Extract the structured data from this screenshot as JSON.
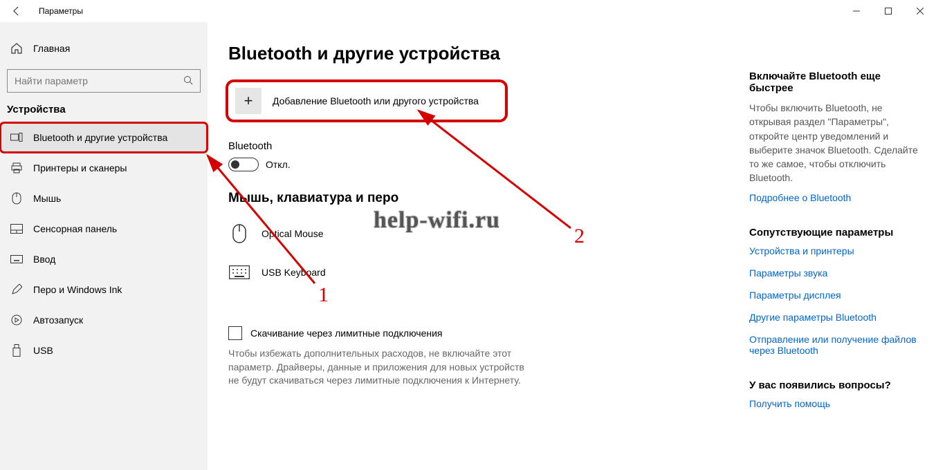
{
  "window": {
    "title": "Параметры"
  },
  "sidebar": {
    "home": "Главная",
    "search_placeholder": "Найти параметр",
    "section": "Устройства",
    "items": [
      {
        "label": "Bluetooth и другие устройства",
        "icon": "devices"
      },
      {
        "label": "Принтеры и сканеры",
        "icon": "printer"
      },
      {
        "label": "Мышь",
        "icon": "mouse"
      },
      {
        "label": "Сенсорная панель",
        "icon": "touchpad"
      },
      {
        "label": "Ввод",
        "icon": "keyboard"
      },
      {
        "label": "Перо и Windows Ink",
        "icon": "pen"
      },
      {
        "label": "Автозапуск",
        "icon": "autoplay"
      },
      {
        "label": "USB",
        "icon": "usb"
      }
    ]
  },
  "main": {
    "heading": "Bluetooth и другие устройства",
    "add_label": "Добавление Bluetooth или другого устройства",
    "bt_label": "Bluetooth",
    "bt_state": "Откл.",
    "devices_heading": "Мышь, клавиатура и перо",
    "devices": [
      {
        "label": "Optical Mouse"
      },
      {
        "label": "USB Keyboard"
      }
    ],
    "metered_checkbox": "Скачивание через лимитные подключения",
    "metered_desc": "Чтобы избежать дополнительных расходов, не включайте этот параметр. Драйверы, данные и приложения для новых устройств не будут скачиваться через лимитные подключения к Интернету."
  },
  "aside": {
    "g1_title": "Включайте Bluetooth еще быстрее",
    "g1_body": "Чтобы включить Bluetooth, не открывая раздел \"Параметры\", откройте центр уведомлений и выберите значок Bluetooth. Сделайте то же самое, чтобы отключить Bluetooth.",
    "g1_link": "Подробнее о Bluetooth",
    "g2_title": "Сопутствующие параметры",
    "g2_links": [
      "Устройства и принтеры",
      "Параметры звука",
      "Параметры дисплея",
      "Другие параметры Bluetooth",
      "Отправление или получение файлов через Bluetooth"
    ],
    "g3_title": "У вас появились вопросы?",
    "g3_link": "Получить помощь"
  },
  "annotations": {
    "watermark": "help-wifi.ru",
    "num1": "1",
    "num2": "2"
  }
}
